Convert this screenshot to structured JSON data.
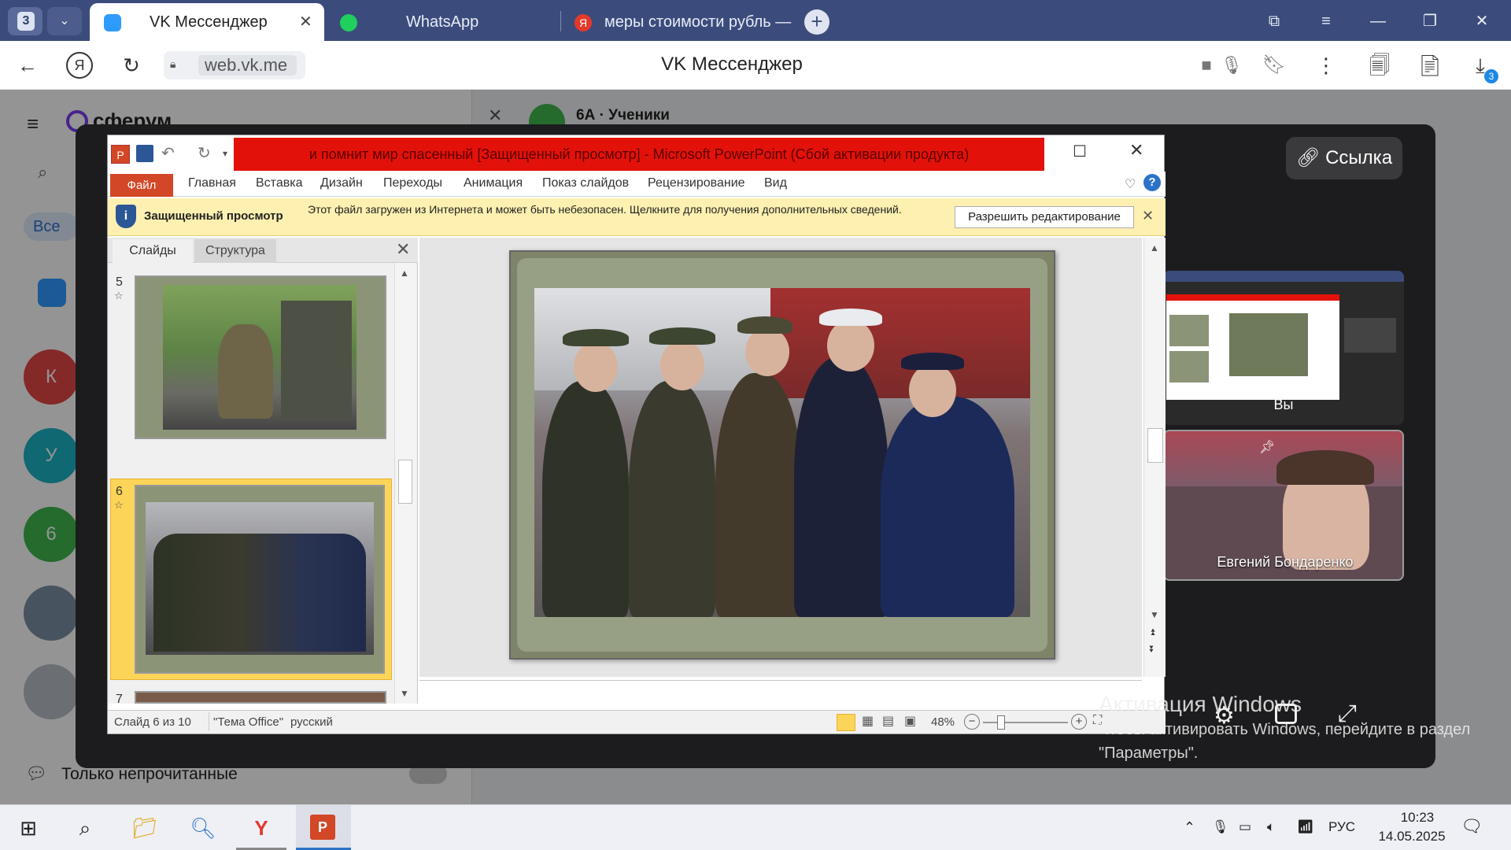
{
  "browser": {
    "tab_count": "3",
    "tabs": [
      {
        "label": "VK Мессенджер",
        "active": true
      },
      {
        "label": "WhatsApp",
        "active": false
      },
      {
        "label": "меры стоимости рубль —",
        "active": false
      }
    ],
    "url": "web.vk.me",
    "page_title": "VK Мессенджер",
    "downloads_badge": "3"
  },
  "vk": {
    "logo": "сферум",
    "filter_all": "Все",
    "chat_title": "6А · Ученики",
    "unread_only": "Только непрочитанные",
    "avatars": [
      {
        "letter": "К",
        "color": "#e64646"
      },
      {
        "letter": "У",
        "color": "#1ab3c4"
      },
      {
        "letter": "6",
        "color": "#3fb94e"
      }
    ]
  },
  "call": {
    "link_label": "Ссылка",
    "participants": [
      {
        "name": "Вы"
      },
      {
        "name": "Евгений Бондаренко"
      }
    ]
  },
  "powerpoint": {
    "title": "и помнит мир спасенный [Защищенный просмотр] - Microsoft PowerPoint (Сбой активации продукта)",
    "ribbon_tabs": [
      "Файл",
      "Главная",
      "Вставка",
      "Дизайн",
      "Переходы",
      "Анимация",
      "Показ слайдов",
      "Рецензирование",
      "Вид"
    ],
    "protected_view": {
      "title": "Защищенный просмотр",
      "message": "Этот файл загружен из Интернета и может быть небезопасен. Щелкните для получения дополнительных сведений.",
      "button": "Разрешить редактирование"
    },
    "panel_tabs": [
      "Слайды",
      "Структура"
    ],
    "slides": [
      {
        "number": "5",
        "star": "☆"
      },
      {
        "number": "6",
        "star": "☆"
      },
      {
        "number": "7"
      }
    ],
    "status": {
      "slide": "Слайд 6 из 10",
      "theme": "\"Тема Office\"",
      "language": "русский",
      "zoom": "48%"
    }
  },
  "windows_activation": {
    "title": "Активация Windows",
    "message": "Чтобы активировать Windows, перейдите в раздел \"Параметры\"."
  },
  "taskbar": {
    "language": "РУС",
    "time": "10:23",
    "date": "14.05.2025"
  },
  "colors": {
    "browser_tabbar": "#3b4c7c",
    "ppt_title_red": "#e2120a",
    "ppt_file_tab": "#d24726",
    "msgbar": "#fdf0b0",
    "selected_slide": "#fcd457"
  }
}
